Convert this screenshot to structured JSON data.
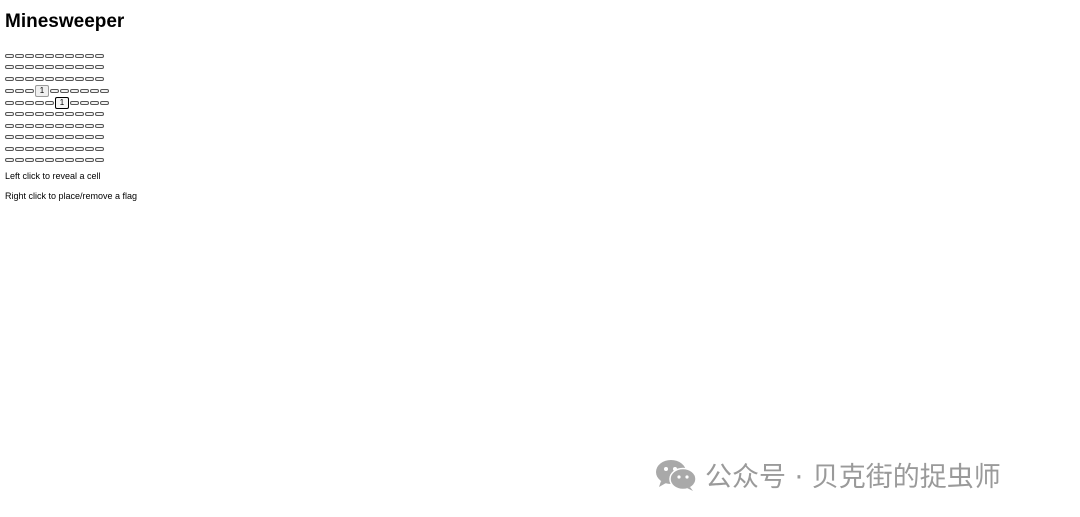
{
  "title": "Minesweeper",
  "board": {
    "rows": [
      [
        "",
        "",
        "",
        "",
        "",
        "",
        "",
        "",
        "",
        ""
      ],
      [
        "",
        "",
        "",
        "",
        "",
        "",
        "",
        "",
        "",
        ""
      ],
      [
        "",
        "",
        "",
        "",
        "",
        "",
        "",
        "",
        "",
        ""
      ],
      [
        "",
        "",
        "",
        "1",
        "",
        "",
        "",
        "",
        "",
        ""
      ],
      [
        "",
        "",
        "",
        "",
        "",
        "1",
        "",
        "",
        "",
        ""
      ],
      [
        "",
        "",
        "",
        "",
        "",
        "",
        "",
        "",
        "",
        ""
      ],
      [
        "",
        "",
        "",
        "",
        "",
        "",
        "",
        "",
        "",
        ""
      ],
      [
        "",
        "",
        "",
        "",
        "",
        "",
        "",
        "",
        "",
        ""
      ],
      [
        "",
        "",
        "",
        "",
        "",
        "",
        "",
        "",
        "",
        ""
      ],
      [
        "",
        "",
        "",
        "",
        "",
        "",
        "",
        "",
        "",
        ""
      ]
    ],
    "focused_cell": [
      4,
      5
    ]
  },
  "instructions": {
    "left_click": "Left click to reveal a cell",
    "right_click": "Right click to place/remove a flag"
  },
  "watermark": {
    "text": "公众号 · 贝克街的捉虫师",
    "icon": "wechat-icon"
  }
}
